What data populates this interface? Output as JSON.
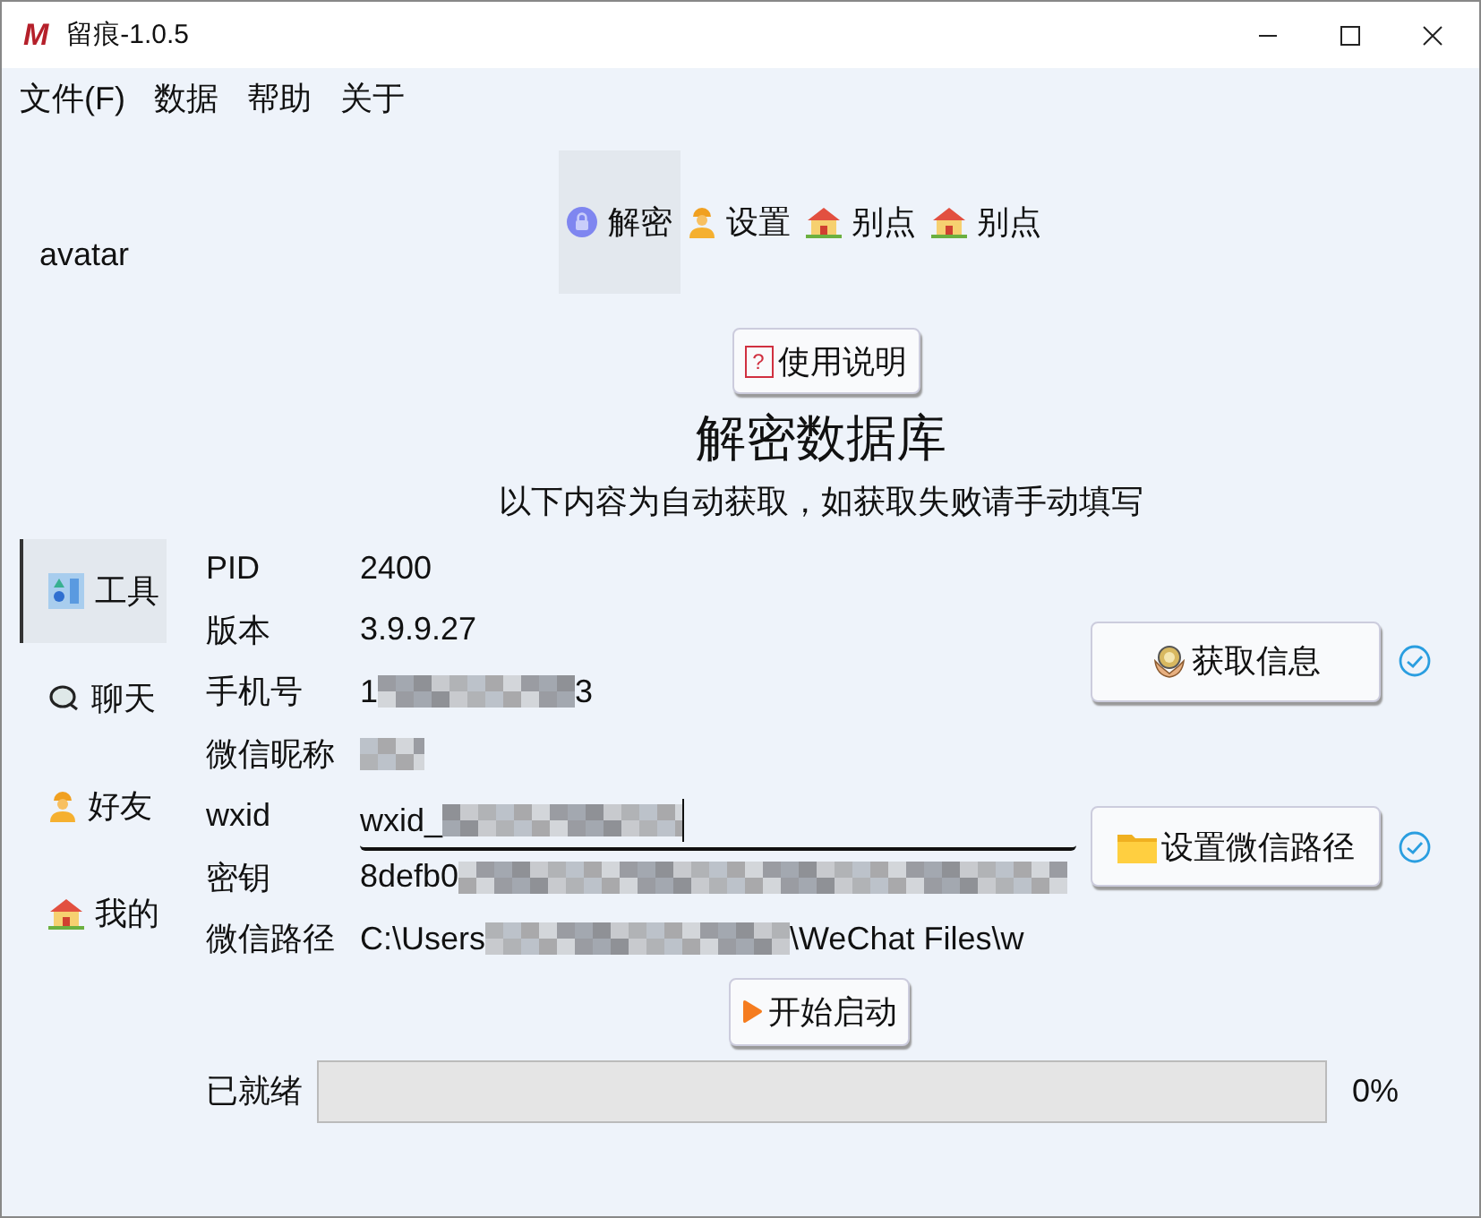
{
  "window": {
    "logo": "M",
    "title": "留痕-1.0.5"
  },
  "menu": [
    "文件(F)",
    "数据",
    "帮助",
    "关于"
  ],
  "avatar": {
    "label": "avatar"
  },
  "tabs": [
    {
      "label": "解密",
      "selected": true
    },
    {
      "label": "设置",
      "selected": false
    },
    {
      "label": "别点",
      "selected": false
    },
    {
      "label": "别点",
      "selected": false
    }
  ],
  "sidebar": {
    "items": [
      {
        "label": "工具",
        "selected": true
      },
      {
        "label": "聊天",
        "selected": false
      },
      {
        "label": "好友",
        "selected": false
      },
      {
        "label": "我的",
        "selected": false
      }
    ]
  },
  "help_button": {
    "icon_char": "?",
    "label": "使用说明"
  },
  "heading": "解密数据库",
  "subtitle": "以下内容为自动获取，如获取失败请手动填写",
  "fields": [
    {
      "label": "PID",
      "kind": "text",
      "value_start": "2400"
    },
    {
      "label": "版本",
      "kind": "text",
      "value_start": "3.9.9.27"
    },
    {
      "label": "手机号",
      "kind": "text",
      "value_start": "1",
      "redacted": true,
      "value_end": "3"
    },
    {
      "label": "微信昵称",
      "kind": "text",
      "redacted": true
    },
    {
      "label": "wxid",
      "kind": "input",
      "value_start": "wxid_",
      "redacted": true
    },
    {
      "label": "密钥",
      "kind": "text",
      "value_start": "8defb0",
      "redacted": true
    },
    {
      "label": "微信路径",
      "kind": "text",
      "value_start": "C:\\Users",
      "redacted": true,
      "value_end": "\\WeChat Files\\w"
    }
  ],
  "actions": [
    {
      "label": "获取信息",
      "status_ok": true
    },
    {
      "label": "设置微信路径",
      "status_ok": true
    }
  ],
  "start_button": {
    "label": "开始启动"
  },
  "progress": {
    "label": "已就绪",
    "level": 0,
    "reading": "0%"
  }
}
